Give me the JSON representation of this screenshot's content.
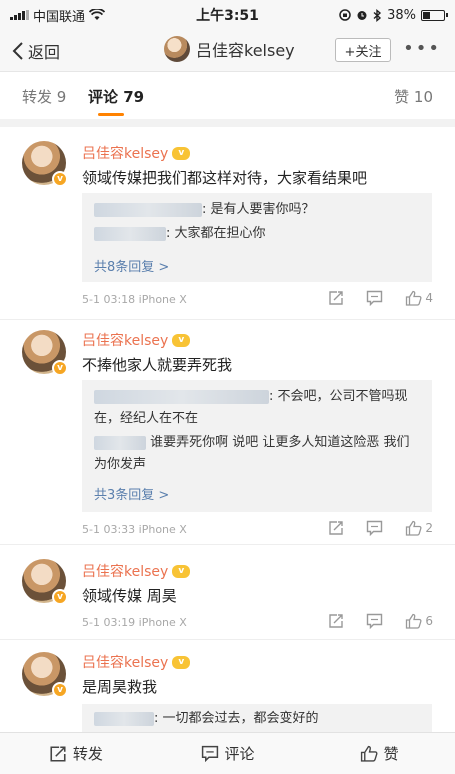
{
  "status_bar": {
    "carrier": "中国联通",
    "time": "上午3:51",
    "battery": "38%",
    "battery_fraction": 0.38
  },
  "nav": {
    "back_label": "返回",
    "username": "吕佳容kelsey",
    "follow_label": "+关注",
    "more_label": "•••"
  },
  "tabs": [
    {
      "label": "转发 9"
    },
    {
      "label": "评论 79"
    },
    {
      "label": "赞 10"
    }
  ],
  "comments": [
    {
      "username": "吕佳容kelsey",
      "content": "领域传媒把我们都这样对待，大家看结果吧",
      "replies": [
        {
          "text": ": 是有人要害你吗？"
        },
        {
          "text": ": 大家都在担心你"
        }
      ],
      "more_replies": "共8条回复 >",
      "meta": "5-1 03:18  iPhone X",
      "likes": "4"
    },
    {
      "username": "吕佳容kelsey",
      "content": "不捧他家人就要弄死我",
      "replies": [
        {
          "text": ": 不会吧，公司不管吗现在，经纪人在不在"
        },
        {
          "text": "谁要弄死你啊    说吧   让更多人知道这险恶  我们为你发声"
        }
      ],
      "more_replies": "共3条回复 >",
      "meta": "5-1 03:33  iPhone X",
      "likes": "2"
    },
    {
      "username": "吕佳容kelsey",
      "content": "领域传媒 周昊",
      "meta": "5-1 03:19  iPhone X",
      "likes": "6"
    },
    {
      "username": "吕佳容kelsey",
      "content": "是周昊救我",
      "replies": [
        {
          "text": ": 一切都会过去，都会变好的"
        }
      ]
    }
  ],
  "bottom_bar": {
    "repost": "转发",
    "comment": "评论",
    "like": "赞"
  },
  "colors": {
    "username": "#eb7350",
    "link": "#5a7fad",
    "accent": "#ff8200"
  }
}
